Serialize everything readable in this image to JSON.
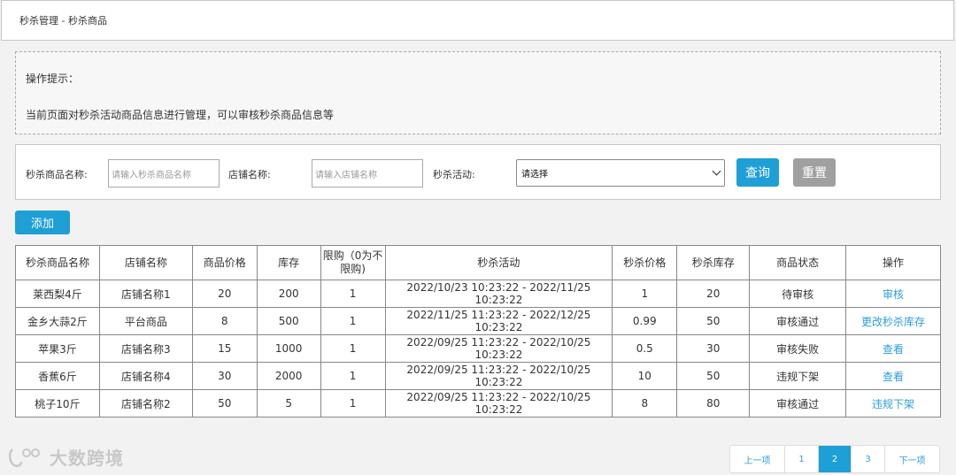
{
  "breadcrumb": "秒杀管理 - 秒杀商品",
  "tips": {
    "title": "操作提示：",
    "desc": "当前页面对秒杀活动商品信息进行管理，可以审核秒杀商品信息等"
  },
  "filter": {
    "product_label": "秒杀商品名称:",
    "product_placeholder": "请输入秒杀商品名称",
    "shop_label": "店铺名称:",
    "shop_placeholder": "请输入店铺名称",
    "activity_label": "秒杀活动:",
    "activity_value": "请选择",
    "query_button": "查询",
    "reset_button": "重置"
  },
  "add_button": "添加",
  "table": {
    "headers": [
      "秒杀商品名称",
      "店铺名称",
      "商品价格",
      "库存",
      "限购（0为不限购)",
      "秒杀活动",
      "秒杀价格",
      "秒杀库存",
      "商品状态",
      "操作"
    ],
    "rows": [
      [
        "莱西梨4斤",
        "店铺名称1",
        "20",
        "200",
        "1",
        "2022/10/23 10:23:22 - 2022/11/25 10:23:22",
        "1",
        "20",
        "待审核",
        "审核"
      ],
      [
        "金乡大蒜2斤",
        "平台商品",
        "8",
        "500",
        "1",
        "2022/11/25 11:23:22 - 2022/12/25 10:23:22",
        "0.99",
        "50",
        "审核通过",
        "更改秒杀库存"
      ],
      [
        "苹果3斤",
        "店铺名称3",
        "15",
        "1000",
        "1",
        "2022/09/25 11:23:22 - 2022/10/25 10:23:22",
        "0.5",
        "30",
        "审核失败",
        "查看"
      ],
      [
        "香蕉6斤",
        "店铺名称4",
        "30",
        "2000",
        "1",
        "2022/09/25 11:23:22 - 2022/10/25 10:23:22",
        "10",
        "50",
        "违规下架",
        "查看"
      ],
      [
        "桃子10斤",
        "店铺名称2",
        "50",
        "5",
        "1",
        "2022/09/25 11:23:22 - 2022/10/25 10:23:22",
        "8",
        "80",
        "审核通过",
        "违规下架"
      ]
    ]
  },
  "pager": {
    "prev": "上一项",
    "pages": [
      "1",
      "2",
      "3"
    ],
    "current": "2",
    "next": "下一项"
  },
  "watermark": "大数跨境",
  "colors": {
    "accent": "#1e9fd6",
    "link": "#2d9dd6",
    "reset": "#a0a0a0"
  }
}
